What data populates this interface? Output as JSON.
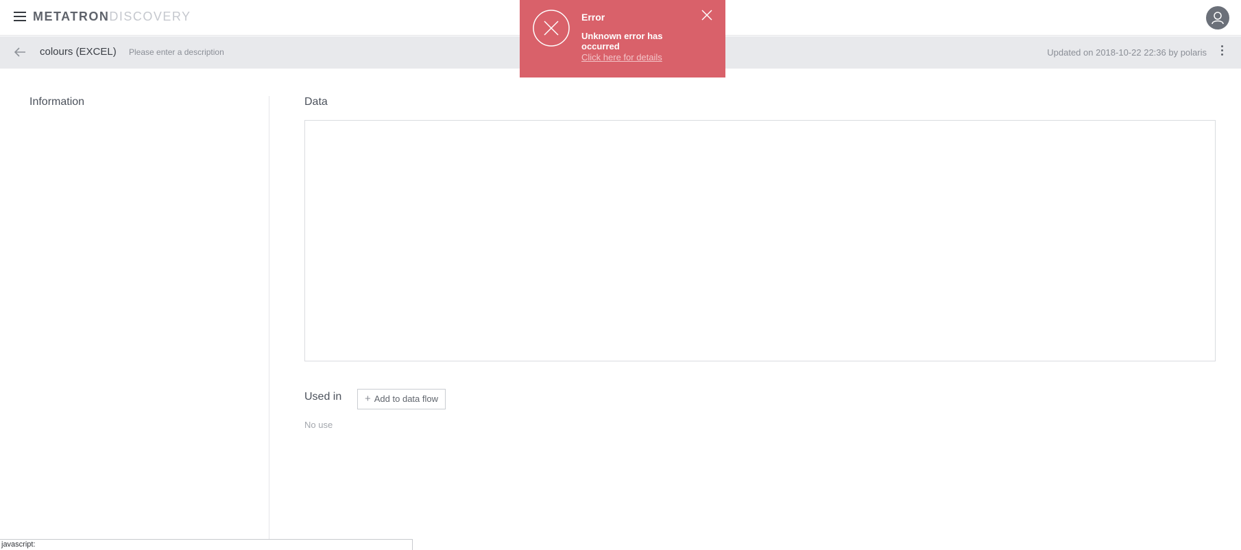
{
  "header": {
    "logo_part1": "METATRON",
    "logo_part2": "DISCOVERY",
    "menu_icon": "hamburger-icon",
    "avatar_icon": "user-avatar-icon"
  },
  "dataset": {
    "title": "colours (EXCEL)",
    "description_placeholder": "Please enter a description",
    "updated": "Updated on 2018-10-22 22:36 by polaris"
  },
  "left_panel": {
    "title": "Information"
  },
  "main": {
    "data_title": "Data",
    "used_in_title": "Used in",
    "add_to_dataflow_label": "Add to data flow",
    "no_use_label": "No use"
  },
  "toast": {
    "title": "Error",
    "message": "Unknown error has occurred",
    "link": "Click here for details",
    "color": "#d9616a"
  },
  "status_bar": {
    "text": "javascript:"
  }
}
